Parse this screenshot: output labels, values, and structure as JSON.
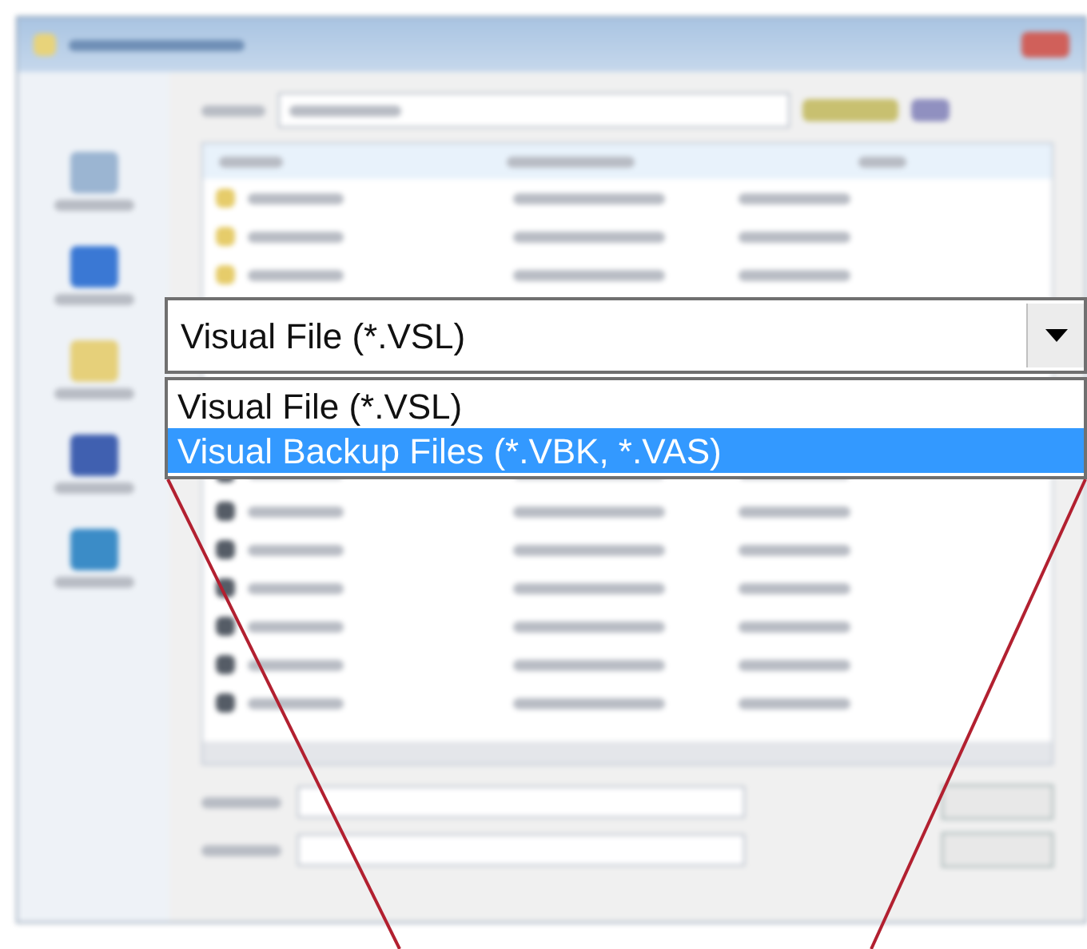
{
  "file_type_dropdown": {
    "value": "Visual File (*.VSL)",
    "options": [
      {
        "label": "Visual File (*.VSL)",
        "highlighted": false
      },
      {
        "label": "Visual Backup Files (*.VBK, *.VAS)",
        "highlighted": true
      }
    ]
  }
}
